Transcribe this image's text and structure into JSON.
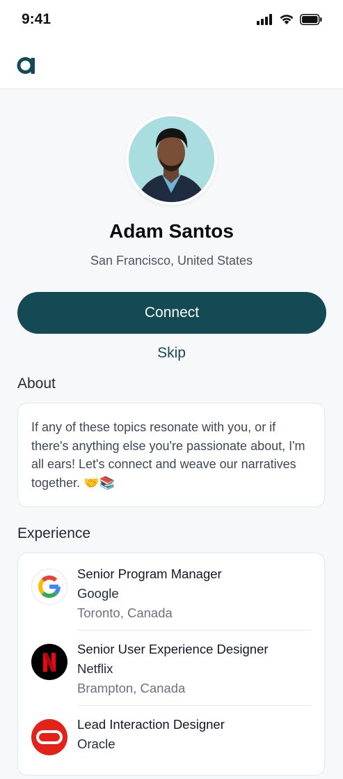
{
  "status_bar": {
    "time": "9:41"
  },
  "header": {
    "logo_text": "a"
  },
  "profile": {
    "name": "Adam Santos",
    "location": "San Francisco, United States"
  },
  "actions": {
    "connect_label": "Connect",
    "skip_label": "Skip"
  },
  "about": {
    "title": "About",
    "text": "If any of these topics resonate with you, or if there's anything else you're passionate about, I'm all ears! Let's connect and weave our narratives together. 🤝📚"
  },
  "experience": {
    "title": "Experience",
    "items": [
      {
        "title": "Senior Program Manager",
        "company": "Google",
        "location": "Toronto, Canada",
        "logo": "google-logo"
      },
      {
        "title": "Senior User Experience Designer",
        "company": "Netflix",
        "location": "Brampton, Canada",
        "logo": "netflix-logo"
      },
      {
        "title": "Lead Interaction Designer",
        "company": "Oracle",
        "location": "",
        "logo": "oracle-logo"
      }
    ]
  },
  "colors": {
    "brand": "#134a54",
    "background": "#f7f8fa"
  }
}
